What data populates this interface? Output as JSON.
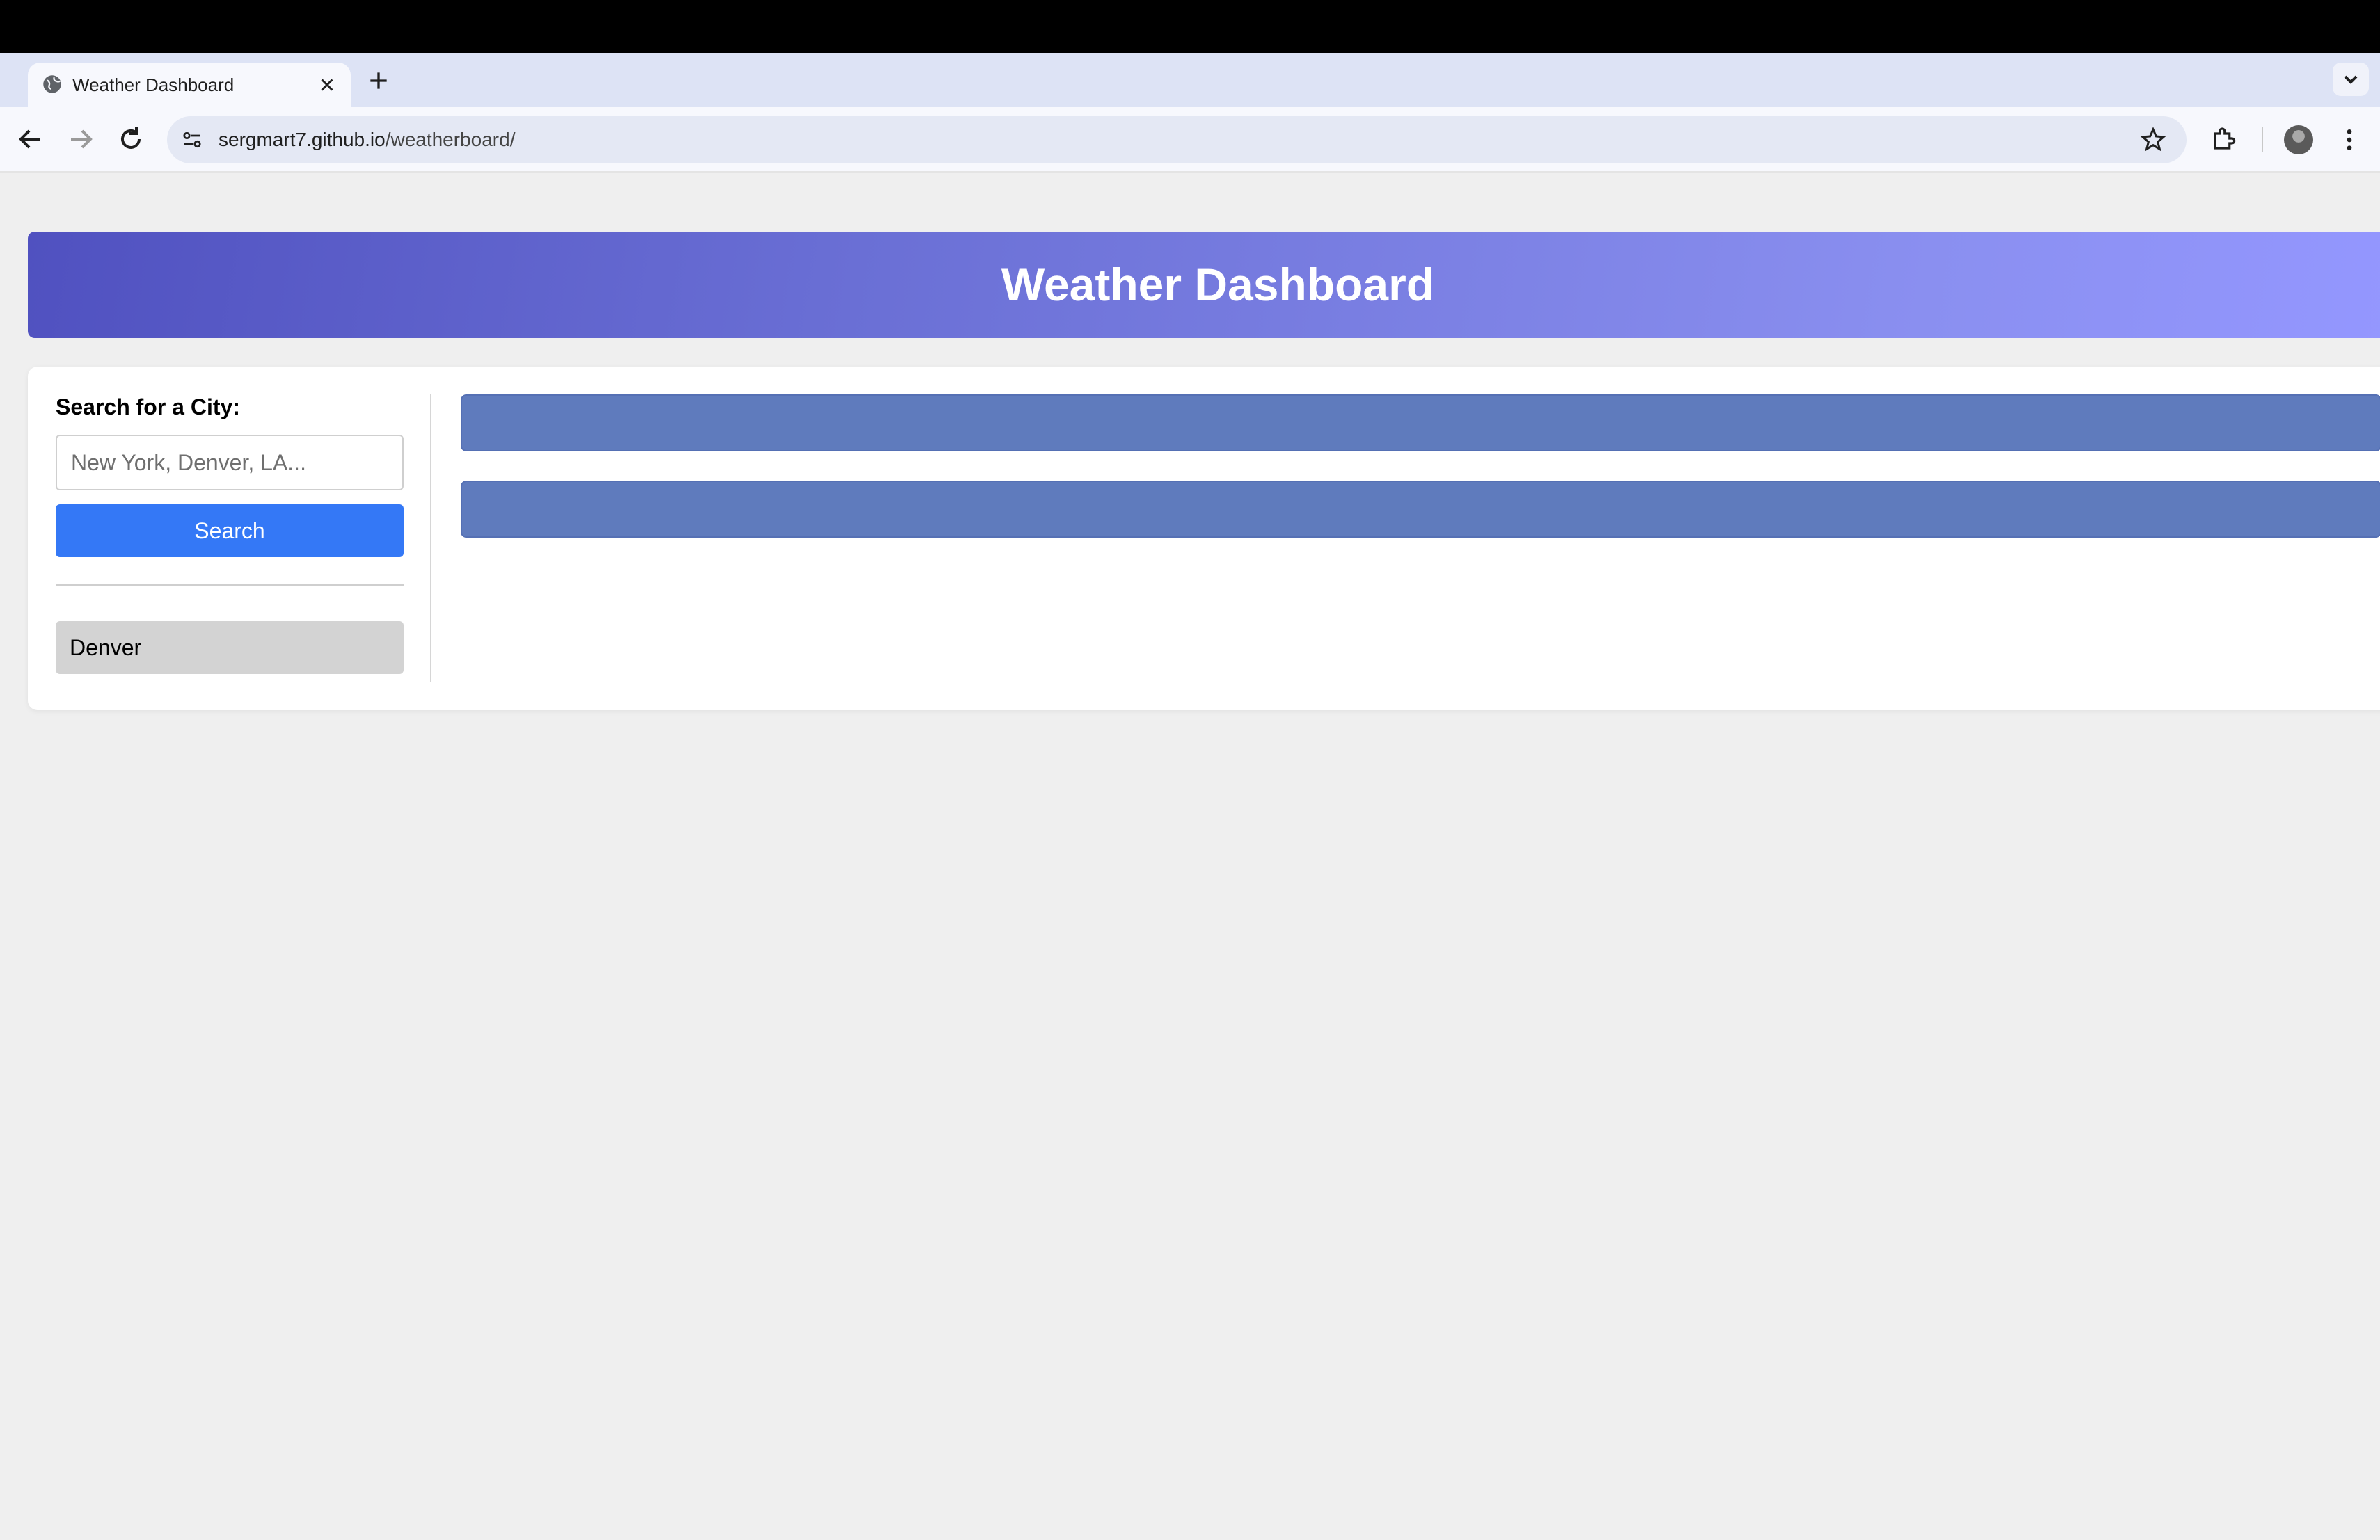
{
  "browser": {
    "tab": {
      "title": "Weather Dashboard"
    },
    "url": {
      "host": "sergmart7.github.io",
      "path": "/weatherboard/"
    }
  },
  "page": {
    "title": "Weather Dashboard",
    "search": {
      "label": "Search for a City:",
      "placeholder": "New York, Denver, LA...",
      "value": "",
      "button_label": "Search"
    },
    "history": [
      "Denver"
    ],
    "results": {
      "bar_count": 2,
      "bar_color": "#5f7bbd"
    }
  },
  "colors": {
    "header_gradient_start": "#5051c0",
    "header_gradient_end": "#9497ff",
    "search_button": "#3478f6",
    "history_item_bg": "#d3d3d3",
    "page_bg": "#efefef"
  },
  "icons": [
    "globe-icon",
    "close-icon",
    "plus-icon",
    "back-icon",
    "forward-icon",
    "reload-icon",
    "site-settings-icon",
    "star-icon",
    "extensions-icon",
    "more-vert-icon",
    "chevron-down-icon"
  ]
}
